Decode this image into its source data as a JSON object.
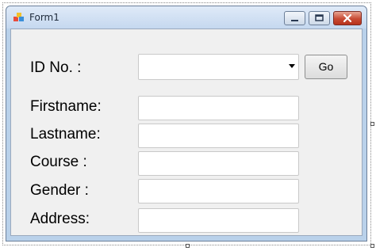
{
  "window": {
    "title": "Form1"
  },
  "form": {
    "id_label": "ID No. :",
    "id_value": "",
    "go_button": "Go",
    "firstname_label": "Firstname:",
    "firstname_value": "",
    "lastname_label": "Lastname:",
    "lastname_value": "",
    "course_label": "Course :",
    "course_value": "",
    "gender_label": "Gender :",
    "gender_value": "",
    "address_label": "Address:",
    "address_value": ""
  },
  "icons": {
    "app": "winforms-app-icon",
    "minimize": "minimize-icon",
    "maximize": "maximize-icon",
    "close": "close-icon",
    "dropdown": "chevron-down-icon"
  },
  "colors": {
    "client_background": "#f0f0f0",
    "titlebar": "#c5d8ef",
    "close_button": "#c74b34"
  }
}
